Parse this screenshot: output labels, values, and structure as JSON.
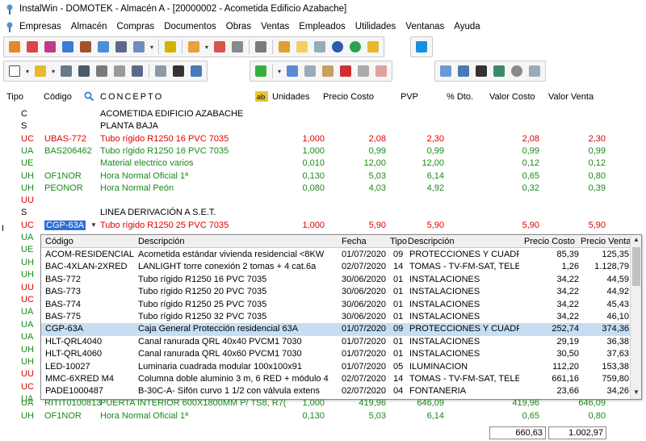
{
  "window": {
    "title": "InstalWin - DOMOTEK - Almacén A - [20000002 - Acometida Edificio Azabache]"
  },
  "menu": [
    "Empresas",
    "Almacén",
    "Compras",
    "Documentos",
    "Obras",
    "Ventas",
    "Empleados",
    "Utilidades",
    "Ventanas",
    "Ayuda"
  ],
  "grid": {
    "headers": {
      "tipo": "Tipo",
      "codigo": "Código",
      "concepto": "CONCEPTO",
      "unidades": "Unidades",
      "precio_costo": "Precio Costo",
      "pvp": "PVP",
      "dto": "% Dto.",
      "valor_costo": "Valor Costo",
      "valor_venta": "Valor Venta"
    },
    "rows": [
      {
        "tipo": "C",
        "codigo": "",
        "concepto": "ACOMETIDA EDIFICIO AZABACHE",
        "unidades": "",
        "pc": "",
        "pvp": "",
        "vc": "",
        "vv": "",
        "color": "black"
      },
      {
        "tipo": "S",
        "codigo": "",
        "concepto": "PLANTA BAJA",
        "unidades": "",
        "pc": "",
        "pvp": "",
        "vc": "",
        "vv": "",
        "color": "black"
      },
      {
        "tipo": "UC",
        "codigo": "UBAS-772",
        "concepto": "Tubo rígido R1250 16 PVC 7035",
        "unidades": "1,000",
        "pc": "2,08",
        "pvp": "2,30",
        "vc": "2,08",
        "vv": "2,30",
        "color": "red"
      },
      {
        "tipo": "UA",
        "codigo": "BAS206462",
        "concepto": "Tubo rígido R1250 16 PVC 7035",
        "unidades": "1,000",
        "pc": "0,99",
        "pvp": "0,99",
        "vc": "0,99",
        "vv": "0,99",
        "color": "green"
      },
      {
        "tipo": "UE",
        "codigo": "",
        "concepto": "Material electrico varios",
        "unidades": "0,010",
        "pc": "12,00",
        "pvp": "12,00",
        "vc": "0,12",
        "vv": "0,12",
        "color": "green"
      },
      {
        "tipo": "UH",
        "codigo": "OF1NOR",
        "concepto": "Hora Normal Oficial 1ª",
        "unidades": "0,130",
        "pc": "5,03",
        "pvp": "6,14",
        "vc": "0,65",
        "vv": "0,80",
        "color": "green"
      },
      {
        "tipo": "UH",
        "codigo": "PEONOR",
        "concepto": "Hora Normal Peón",
        "unidades": "0,080",
        "pc": "4,03",
        "pvp": "4,92",
        "vc": "0,32",
        "vv": "0,39",
        "color": "green"
      },
      {
        "tipo": "UU",
        "codigo": "",
        "concepto": "",
        "unidades": "",
        "pc": "",
        "pvp": "",
        "vc": "",
        "vv": "",
        "color": "red"
      },
      {
        "tipo": "S",
        "codigo": "",
        "concepto": "LINEA DERIVACIÓN A S.E.T.",
        "unidades": "",
        "pc": "",
        "pvp": "",
        "vc": "",
        "vv": "",
        "color": "black"
      },
      {
        "tipo": "UC",
        "codigo": "CGP-63A",
        "concepto": "Tubo rígido R1250 25 PVC 7035",
        "unidades": "1,000",
        "pc": "5,90",
        "pvp": "5,90",
        "vc": "5,90",
        "vv": "5,90",
        "color": "red",
        "selected": true
      }
    ],
    "tail_rows": [
      {
        "tipo": "UA",
        "codigo": "RITIT0100813",
        "concepto": "PUERTA INTERIOR 600X1800MM P/ TS8, R7(",
        "unidades": "1,000",
        "pc": "419,96",
        "pvp": "646,09",
        "vc": "419,96",
        "vv": "646,09",
        "color": "green"
      },
      {
        "tipo": "UH",
        "codigo": "OF1NOR",
        "concepto": "Hora Normal Oficial 1ª",
        "unidades": "0,130",
        "pc": "5,03",
        "pvp": "6,14",
        "vc": "0,65",
        "vv": "0,80",
        "color": "green"
      }
    ],
    "left_tipos_behind_dropdown": [
      "UA",
      "UE",
      "UH",
      "UH",
      "UU",
      "UC",
      "UA",
      "UA",
      "UA",
      "UH",
      "UH",
      "UU",
      "UC",
      "UA"
    ]
  },
  "dropdown": {
    "headers": {
      "codigo": "Código",
      "descripcion": "Descripción",
      "fecha": "Fecha",
      "tipo": "Tipo",
      "tipo_desc": "Descripción",
      "precio_costo": "Precio Costo",
      "precio_venta": "Precio Venta"
    },
    "items": [
      {
        "codigo": "ACOM-RESIDENCIAL",
        "descripcion": "Acometida estándar vivienda residencial <8KW",
        "fecha": "01/07/2020",
        "tipo": "09",
        "tipo_desc": "PROTECCIONES Y CUADROS",
        "pc": "85,39",
        "pv": "125,35"
      },
      {
        "codigo": "BAC-4XLAN-2XRED",
        "descripcion": "LANLIGHT torre conexión 2 tomas + 4 cat.6a",
        "fecha": "02/07/2020",
        "tipo": "14",
        "tipo_desc": "TOMAS - TV-FM-SAT, TELEFO",
        "pc": "1,26",
        "pv": "1.128,79"
      },
      {
        "codigo": "BAS-772",
        "descripcion": "Tubo rígido R1250 16 PVC 7035",
        "fecha": "30/06/2020",
        "tipo": "01",
        "tipo_desc": "INSTALACIONES",
        "pc": "34,22",
        "pv": "44,59"
      },
      {
        "codigo": "BAS-773",
        "descripcion": "Tubo rígido R1250 20 PVC 7035",
        "fecha": "30/06/2020",
        "tipo": "01",
        "tipo_desc": "INSTALACIONES",
        "pc": "34,22",
        "pv": "44,92"
      },
      {
        "codigo": "BAS-774",
        "descripcion": "Tubo rígido R1250 25 PVC 7035",
        "fecha": "30/06/2020",
        "tipo": "01",
        "tipo_desc": "INSTALACIONES",
        "pc": "34,22",
        "pv": "45,43"
      },
      {
        "codigo": "BAS-775",
        "descripcion": "Tubo rígido R1250 32 PVC 7035",
        "fecha": "30/06/2020",
        "tipo": "01",
        "tipo_desc": "INSTALACIONES",
        "pc": "34,22",
        "pv": "46,10"
      },
      {
        "codigo": "CGP-63A",
        "descripcion": "Caja General Protección residencial 63A",
        "fecha": "01/07/2020",
        "tipo": "09",
        "tipo_desc": "PROTECCIONES Y CUADROS",
        "pc": "252,74",
        "pv": "374,36",
        "highlight": true
      },
      {
        "codigo": "HLT-QRL4040",
        "descripcion": "Canal ranurada QRL 40x40 PVCM1 7030",
        "fecha": "01/07/2020",
        "tipo": "01",
        "tipo_desc": "INSTALACIONES",
        "pc": "29,19",
        "pv": "36,38"
      },
      {
        "codigo": "HLT-QRL4060",
        "descripcion": "Canal ranurada QRL 40x60 PVCM1 7030",
        "fecha": "01/07/2020",
        "tipo": "01",
        "tipo_desc": "INSTALACIONES",
        "pc": "30,50",
        "pv": "37,63"
      },
      {
        "codigo": "LED-10027",
        "descripcion": "Luminaria cuadrada modular 100x100x91",
        "fecha": "01/07/2020",
        "tipo": "05",
        "tipo_desc": "ILUMINACION",
        "pc": "112,20",
        "pv": "153,38"
      },
      {
        "codigo": "MMC-6XRED M4",
        "descripcion": "Columna doble aluminio 3 m, 6 RED + módulo 4",
        "fecha": "02/07/2020",
        "tipo": "14",
        "tipo_desc": "TOMAS - TV-FM-SAT, TELEFO",
        "pc": "661,16",
        "pv": "759,80"
      },
      {
        "codigo": "PADE1000487",
        "descripcion": "B-30C-A- Sifón curvo 1 1/2 con válvula extens",
        "fecha": "02/07/2020",
        "tipo": "04",
        "tipo_desc": "FONTANERIA",
        "pc": "23,66",
        "pv": "34,26"
      }
    ]
  },
  "totals": {
    "valor_costo": "660,63",
    "valor_venta": "1.002,97"
  },
  "colors": {
    "red": "#e00000",
    "green": "#1a8a1a",
    "highlight": "#c7def2",
    "selected_code": "#2a6fd6"
  }
}
